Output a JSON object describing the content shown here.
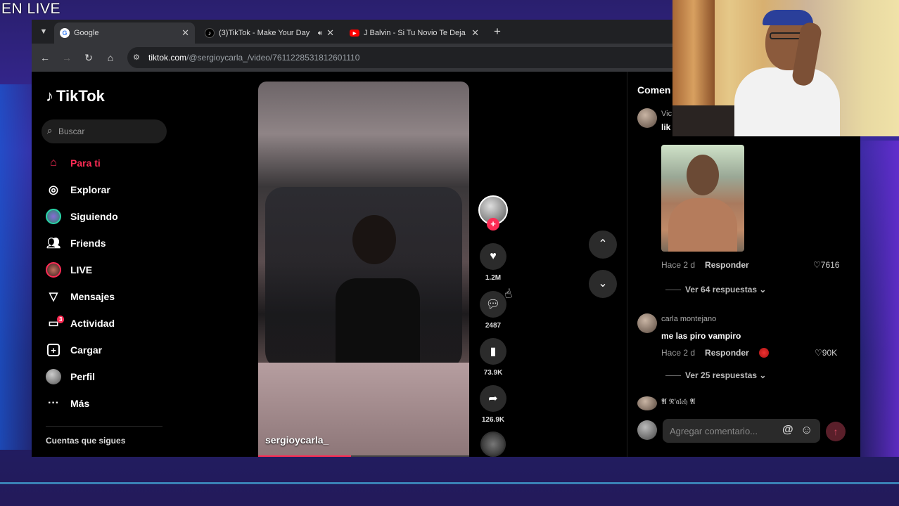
{
  "stream": {
    "label": "EN LIVE"
  },
  "browser": {
    "tabs": [
      {
        "title": "Google",
        "active": true,
        "icon": "google-icon"
      },
      {
        "title": "(3)TikTok - Make Your Day",
        "active": false,
        "icon": "tiktok-icon"
      },
      {
        "title": "J Balvin - Si Tu Novio Te Deja Sc",
        "active": false,
        "icon": "youtube-icon"
      }
    ],
    "url": {
      "host": "tiktok.com",
      "path": "/@sergioycarla_/video/7611228531812601110"
    }
  },
  "sidebar": {
    "logo": "TikTok",
    "search_placeholder": "Buscar",
    "items": [
      {
        "label": "Para ti",
        "icon": "home-icon",
        "active": true
      },
      {
        "label": "Explorar",
        "icon": "compass-icon"
      },
      {
        "label": "Siguiendo",
        "icon": "following-avatar-icon"
      },
      {
        "label": "Friends",
        "icon": "friends-icon"
      },
      {
        "label": "LIVE",
        "icon": "live-avatar-icon"
      },
      {
        "label": "Mensajes",
        "icon": "send-icon"
      },
      {
        "label": "Actividad",
        "icon": "activity-icon",
        "badge": "3"
      },
      {
        "label": "Cargar",
        "icon": "upload-icon"
      },
      {
        "label": "Perfil",
        "icon": "profile-avatar-icon"
      },
      {
        "label": "Más",
        "icon": "more-icon"
      }
    ],
    "following_title": "Cuentas que sigues"
  },
  "video": {
    "username": "sergioycarla_",
    "progress": 0.44
  },
  "actions": {
    "likes": "1.2M",
    "comments": "2487",
    "saves": "73.9K",
    "shares": "126.9K"
  },
  "comments": {
    "title": "Comen",
    "items": [
      {
        "user": "Vic",
        "text": "lik",
        "time": "Hace 2 d",
        "reply": "Responder",
        "likes": "7616",
        "replies": "Ver 64 respuestas"
      },
      {
        "user": "carla montejano",
        "text": "me las piro vampiro",
        "time": "Hace 2 d",
        "reply": "Responder",
        "likes": "90K",
        "replies": "Ver 25 respuestas"
      },
      {
        "user": "𝕬 ℜ'𝔞𝔩𝔢𝔥 𝕬"
      }
    ],
    "input_placeholder": "Agregar comentario..."
  },
  "colors": {
    "accent": "#fe2c55",
    "background": "#000000"
  }
}
